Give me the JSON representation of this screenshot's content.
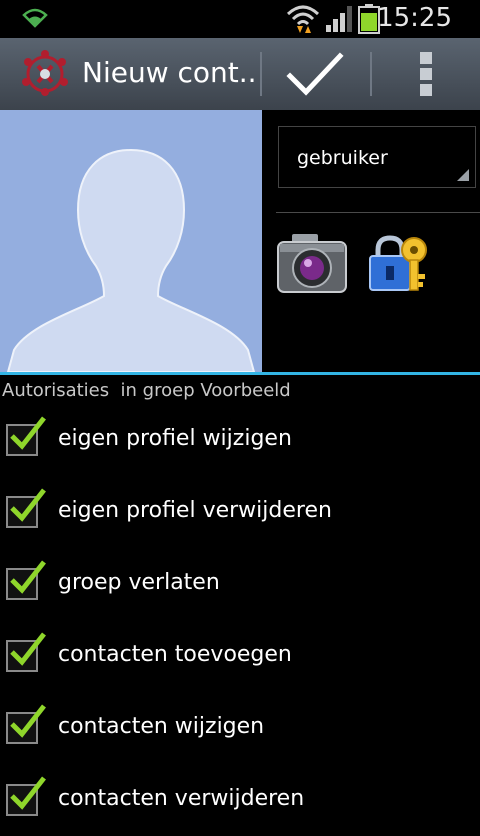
{
  "status_bar": {
    "time": "15:25",
    "icons": [
      "app-notification-icon",
      "wifi-icon",
      "signal-icon",
      "battery-icon"
    ]
  },
  "action_bar": {
    "title": "Nieuw cont..",
    "icons": [
      "app-logo-icon",
      "checkmark-icon",
      "overflow-menu-icon"
    ]
  },
  "contact": {
    "account_spinner_value": "gebruiker",
    "icons": [
      "avatar-placeholder",
      "camera-icon",
      "lock-key-icon"
    ]
  },
  "permissions": {
    "header": "Autorisaties  in groep Voorbeeld",
    "items": [
      {
        "label": "eigen profiel wijzigen",
        "checked": true
      },
      {
        "label": "eigen profiel verwijderen",
        "checked": true
      },
      {
        "label": "groep verlaten",
        "checked": true
      },
      {
        "label": "contacten toevoegen",
        "checked": true
      },
      {
        "label": "contacten wijzigen",
        "checked": true
      },
      {
        "label": "contacten verwijderen",
        "checked": true
      }
    ]
  },
  "colors": {
    "accent": "#33b5e5",
    "check": "#8fd62b",
    "photo_bg": "#94aedf"
  }
}
